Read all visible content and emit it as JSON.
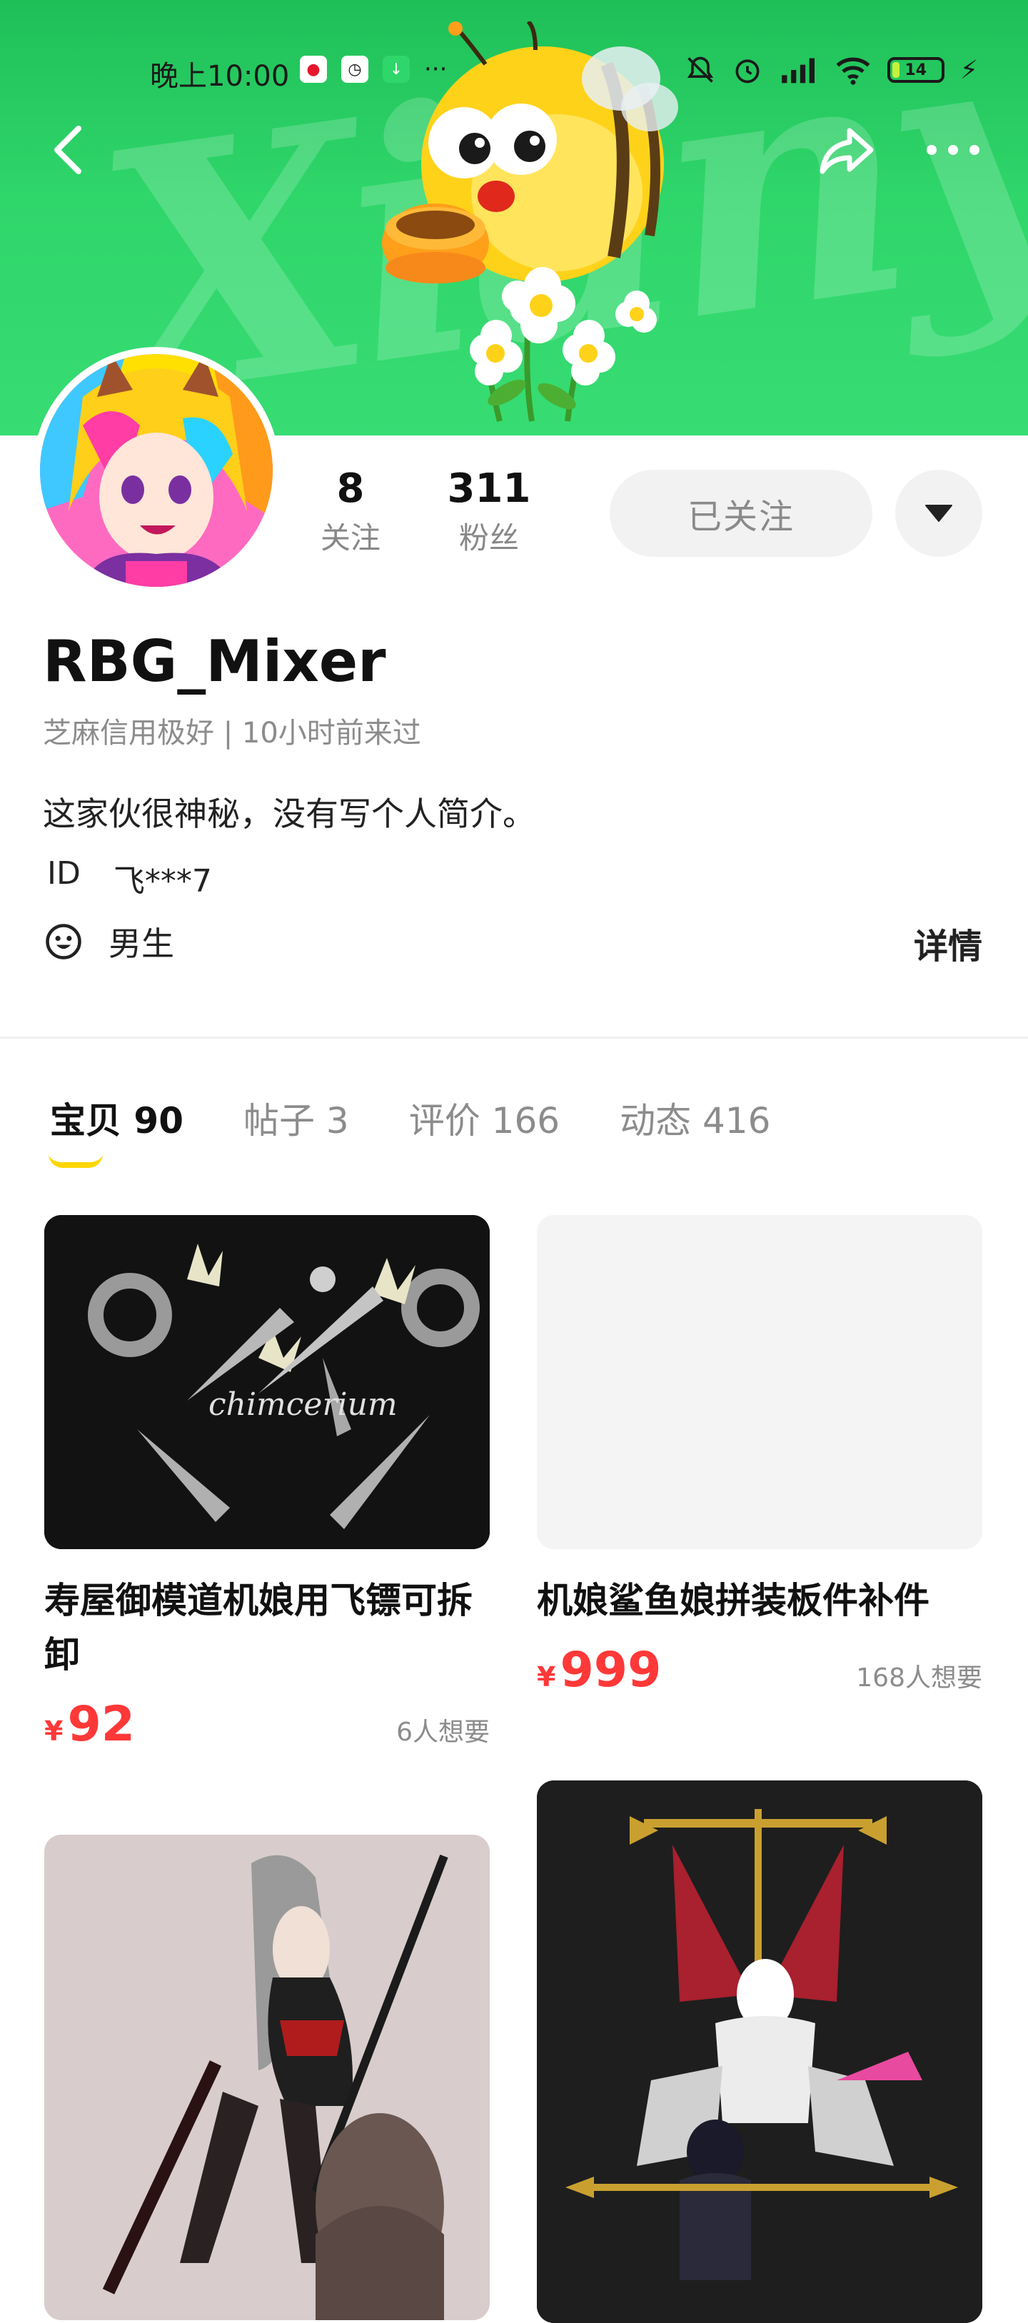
{
  "status_bar": {
    "time": "晚上10:00",
    "battery": "14"
  },
  "profile": {
    "following_count": "8",
    "following_label": "关注",
    "followers_count": "311",
    "followers_label": "粉丝",
    "follow_button": "已关注",
    "username": "RBG_Mixer",
    "meta": "芝麻信用极好 | 10小时前来过",
    "bio": "这家伙很神秘，没有写个人简介。",
    "id_label": "ID",
    "id_value": "飞***7",
    "gender": "男生",
    "details_link": "详情"
  },
  "tabs": [
    {
      "label": "宝贝",
      "count": "90",
      "active": true
    },
    {
      "label": "帖子",
      "count": "3",
      "active": false
    },
    {
      "label": "评价",
      "count": "166",
      "active": false
    },
    {
      "label": "动态",
      "count": "416",
      "active": false
    }
  ],
  "products": [
    {
      "title": "寿屋御模道机娘用飞镖可拆卸",
      "currency": "¥",
      "price": "92",
      "wants": "6人想要"
    },
    {
      "title": "机娘鲨鱼娘拼装板件补件",
      "currency": "¥",
      "price": "999",
      "wants": "168人想要"
    }
  ],
  "product_image_text": "chimcerium",
  "colors": {
    "banner": "#2fd66a",
    "price": "#ff3838",
    "tab_underline": "#ffd600"
  }
}
